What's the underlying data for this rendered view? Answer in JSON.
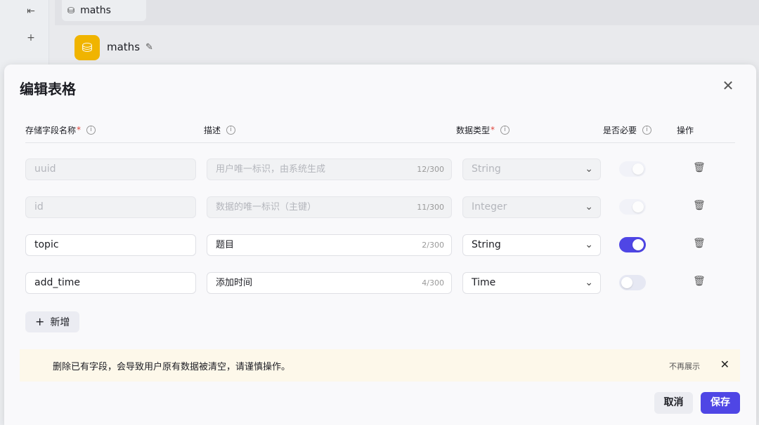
{
  "background": {
    "tab_label": "maths",
    "db_title": "maths"
  },
  "dialog": {
    "title": "编辑表格",
    "headers": {
      "field_name": "存储字段名称",
      "description": "描述",
      "data_type": "数据类型",
      "required": "是否必要",
      "actions": "操作"
    },
    "rows": [
      {
        "name": "uuid",
        "description": "用户唯一标识，由系统生成",
        "count": "12/300",
        "type": "String",
        "required": true,
        "disabled": true
      },
      {
        "name": "id",
        "description": "数据的唯一标识（主键）",
        "count": "11/300",
        "type": "Integer",
        "required": true,
        "disabled": true
      },
      {
        "name": "topic",
        "description": "题目",
        "count": "2/300",
        "type": "String",
        "required": true,
        "disabled": false
      },
      {
        "name": "add_time",
        "description": "添加时间",
        "count": "4/300",
        "type": "Time",
        "required": false,
        "disabled": false
      }
    ],
    "add_label": "新增",
    "warning": {
      "text": "删除已有字段，会导致用户原有数据被清空，请谨慎操作。",
      "dismiss_label": "不再展示"
    },
    "cancel_label": "取消",
    "save_label": "保存"
  }
}
